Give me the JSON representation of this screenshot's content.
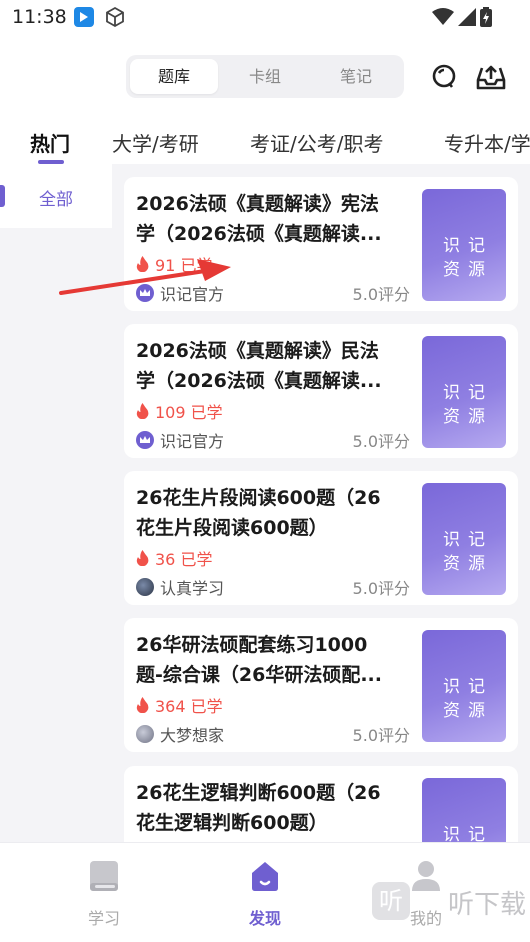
{
  "status": {
    "time": "11:38"
  },
  "header": {
    "segments": [
      "题库",
      "卡组",
      "笔记"
    ]
  },
  "categories": [
    "热门",
    "大学/考研",
    "考证/公考/职考",
    "专升本/学"
  ],
  "sidebar": {
    "items": [
      {
        "label": "全部"
      }
    ]
  },
  "cards": [
    {
      "title_l1": "2026法硕《真题解读》宪法",
      "title_l2": "学（2026法硕《真题解读...",
      "studied": "91 已学",
      "author": "识记官方",
      "rating": "5.0评分",
      "cover_l1": "识记",
      "cover_l2": "资源"
    },
    {
      "title_l1": "2026法硕《真题解读》民法",
      "title_l2": "学（2026法硕《真题解读...",
      "studied": "109 已学",
      "author": "识记官方",
      "rating": "5.0评分",
      "cover_l1": "识记",
      "cover_l2": "资源"
    },
    {
      "title_l1": "26花生片段阅读600题（26",
      "title_l2": "花生片段阅读600题）",
      "studied": "36 已学",
      "author": "认真学习",
      "rating": "5.0评分",
      "cover_l1": "识记",
      "cover_l2": "资源"
    },
    {
      "title_l1": "26华研法硕配套练习1000",
      "title_l2": "题-综合课（26华研法硕配...",
      "studied": "364 已学",
      "author": "大梦想家",
      "rating": "5.0评分",
      "cover_l1": "识记",
      "cover_l2": "资源"
    },
    {
      "title_l1": "26花生逻辑判断600题（26",
      "title_l2": "花生逻辑判断600题）",
      "cover_l1": "识记",
      "cover_l2": "资源"
    }
  ],
  "bottom_nav": [
    {
      "label": "学习",
      "icon": "book-icon"
    },
    {
      "label": "发现",
      "icon": "home-icon"
    },
    {
      "label": "我的",
      "icon": "person-icon"
    }
  ],
  "watermark": {
    "box": "听",
    "text": "听下载"
  },
  "colors": {
    "accent": "#6f5fd0",
    "hot": "#f0524a",
    "arrow": "#e53935"
  }
}
